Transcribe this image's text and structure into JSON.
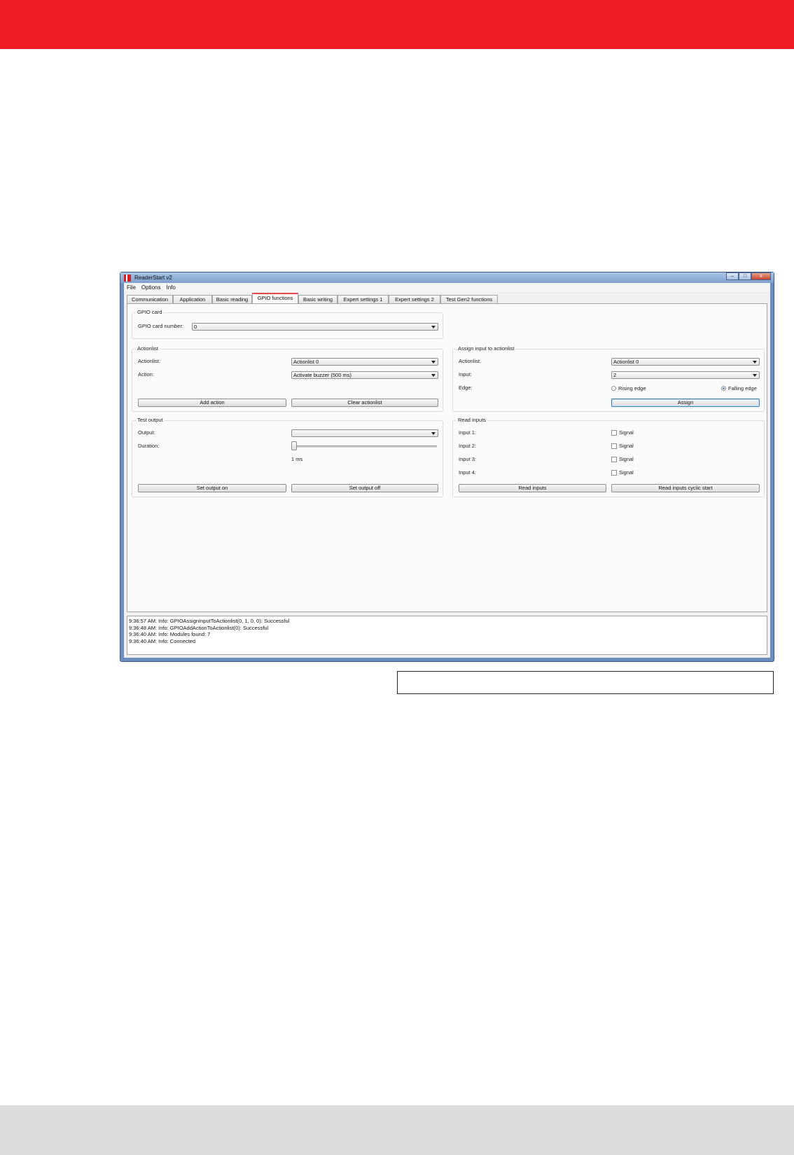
{
  "app": {
    "title": "ReaderStart v2"
  },
  "window_buttons": {
    "minimize": "–",
    "maximize": "□",
    "close": "x"
  },
  "menu": [
    "File",
    "Options",
    "Info"
  ],
  "tabs": [
    "Communication",
    "Application",
    "Basic reading",
    "GPIO functions",
    "Basic writing",
    "Expert settings 1",
    "Expert settings 2",
    "Test Gen2 functions"
  ],
  "active_tab": "GPIO functions",
  "gpio_card": {
    "title": "GPIO card",
    "number_label": "GPIO card number:",
    "number_value": "0"
  },
  "actionlist": {
    "title": "Actionlist",
    "actionlist_label": "Actionlist:",
    "actionlist_value": "Actionlist 0",
    "action_label": "Action:",
    "action_value": "Activate buzzer (500 ms)",
    "add_button": "Add action",
    "clear_button": "Clear actionlist"
  },
  "assign": {
    "title": "Assign input to actionlist",
    "actionlist_label": "Actionlist:",
    "actionlist_value": "Actionlist 0",
    "input_label": "Input:",
    "input_value": "2",
    "edge_label": "Edge:",
    "rising": "Rising edge",
    "falling": "Falling edge",
    "selected_edge": "Falling edge",
    "assign_button": "Assign"
  },
  "test_output": {
    "title": "Test output",
    "output_label": "Output:",
    "output_value": "",
    "duration_label": "Duration:",
    "duration_value": "1 ms",
    "on_button": "Set output on",
    "off_button": "Set output off"
  },
  "read_inputs": {
    "title": "Read inputs",
    "inputs": [
      {
        "label": "Input 1:",
        "signal": "Signal",
        "checked": false
      },
      {
        "label": "Input 2:",
        "signal": "Signal",
        "checked": false
      },
      {
        "label": "Input 3:",
        "signal": "Signal",
        "checked": false
      },
      {
        "label": "Input 4:",
        "signal": "Signal",
        "checked": false
      }
    ],
    "read_button": "Read inputs",
    "cyclic_button": "Read inputs cyclic start"
  },
  "log": [
    "9:36:57 AM: Info: GPIOAssignInputToActionlist(0, 1, 0, 0): Successful",
    "9:36:48 AM: Info: GPIOAddActionToActionlist(0): Successful",
    "9:36:40 AM: Info: Modules found: 7",
    "9:36:40 AM: Info: Connected"
  ],
  "colors": {
    "brand_red": "#ee1c25",
    "footer_gray": "#dcdcdc",
    "active_tab_accent": "#e8484c"
  }
}
